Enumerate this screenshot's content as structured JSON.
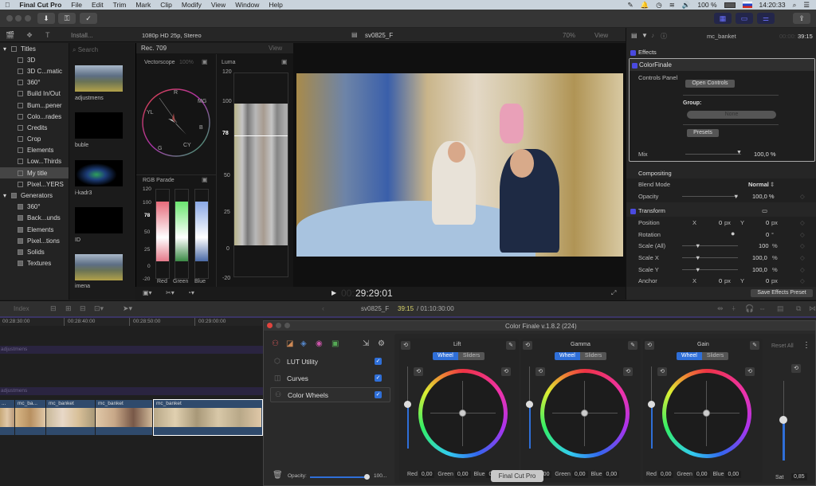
{
  "menubar": {
    "app_name": "Final Cut Pro",
    "items": [
      "File",
      "Edit",
      "Trim",
      "Mark",
      "Clip",
      "Modify",
      "View",
      "Window",
      "Help"
    ],
    "battery": "100 %",
    "clock": "14:20:33"
  },
  "browser_bar": {
    "library_select": "Install...",
    "format": "1080p HD 25p, Stereo",
    "project_name": "sv0825_F",
    "zoom": "70%",
    "view_menu": "View"
  },
  "sidebar": {
    "titles_label": "Titles",
    "title_items": [
      "3D",
      "3D C...matic",
      "360°",
      "Build In/Out",
      "Bum...pener",
      "Colo...rades",
      "Credits",
      "Crop",
      "Elements",
      "Low...Thirds",
      "My title",
      "Pixel...YERS"
    ],
    "selected": "My title",
    "generators_label": "Generators",
    "generator_items": [
      "360°",
      "Back...unds",
      "Elements",
      "Pixel...tions",
      "Solids",
      "Textures"
    ]
  },
  "browser": {
    "search_placeholder": "Search",
    "clips": [
      "adjustmens",
      "buble",
      "i-kadr3",
      "ID",
      "imena"
    ]
  },
  "scopes": {
    "standard": "Rec. 709",
    "view_menu": "View",
    "vectorscope_label": "Vectorscope",
    "vectorscope_pct": "100%",
    "vector_targets": [
      "R",
      "MG",
      "B",
      "CY",
      "G",
      "YL"
    ],
    "luma_label": "Luma",
    "luma_ticks": [
      "120",
      "100",
      "78",
      "50",
      "25",
      "0",
      "-20"
    ],
    "parade_label": "RGB Parade",
    "parade_ticks": [
      "120",
      "100",
      "78",
      "50",
      "25",
      "0",
      "-20"
    ],
    "parade_channels": [
      "Red",
      "Green",
      "Blue"
    ]
  },
  "viewer": {
    "timecode": "29:29:01",
    "timecode_prefix": "00:"
  },
  "inspector": {
    "clip_name": "mc_banket",
    "timecode_dim": "00:00:",
    "timecode": "39:15",
    "effects_label": "Effects",
    "effect_name": "ColorFinale",
    "controls_panel": "Controls Panel",
    "open_controls": "Open Controls",
    "group_label": "Group:",
    "group_value": "None",
    "presets": "Presets",
    "mix_label": "Mix",
    "mix_value": "100,0 %",
    "compositing_label": "Compositing",
    "blend_mode_label": "Blend Mode",
    "blend_mode_value": "Normal",
    "opacity_label": "Opacity",
    "opacity_value": "100,0 %",
    "transform_label": "Transform",
    "position_label": "Position",
    "position_x": "0",
    "position_y": "0",
    "rotation_label": "Rotation",
    "rotation_value": "0",
    "scale_all_label": "Scale (All)",
    "scale_all_value": "100",
    "scale_x_label": "Scale X",
    "scale_x_value": "100,0",
    "scale_y_label": "Scale Y",
    "scale_y_value": "100,0",
    "anchor_label": "Anchor",
    "anchor_x": "0",
    "anchor_y": "0",
    "unit_px": "px",
    "unit_pct": "%",
    "unit_deg": "°",
    "x_label": "X",
    "y_label": "Y",
    "save_preset": "Save Effects Preset"
  },
  "timeline": {
    "index_label": "Index",
    "project": "sv0825_F",
    "position": "39:15",
    "duration": "/ 01:10:30:00",
    "ruler": [
      "00:28:30:00",
      "00:28:40:00",
      "00:28:50:00",
      "00:29:00:00"
    ],
    "lane_labels": [
      "adjustmens",
      "adjustmens"
    ],
    "clips": [
      "...",
      "mc_ba...",
      "mc_banket",
      "mc_banket",
      "mc_banket"
    ]
  },
  "color_finale": {
    "title": "Color Finale v.1.8.2 (224)",
    "layers": [
      {
        "name": "LUT Utility",
        "checked": true
      },
      {
        "name": "Curves",
        "checked": true
      },
      {
        "name": "Color Wheels",
        "checked": true
      }
    ],
    "opacity_label": "Opacity:",
    "opacity_value": "100...",
    "wheel_tab": "Wheel",
    "sliders_tab": "Sliders",
    "reset_all": "Reset All",
    "wheels": [
      {
        "name": "Lift",
        "red": "0,00",
        "green": "0,00",
        "blue": "0,00"
      },
      {
        "name": "Gamma",
        "red": "0,00",
        "green": "0,00",
        "blue": "0,00"
      },
      {
        "name": "Gain",
        "red": "0,00",
        "green": "0,00",
        "blue": "0,00"
      }
    ],
    "red_label": "Red",
    "green_label": "Green",
    "blue_label": "Blue",
    "sat_label": "Sat",
    "sat_value": "0,85",
    "tooltip": "Final Cut Pro"
  }
}
